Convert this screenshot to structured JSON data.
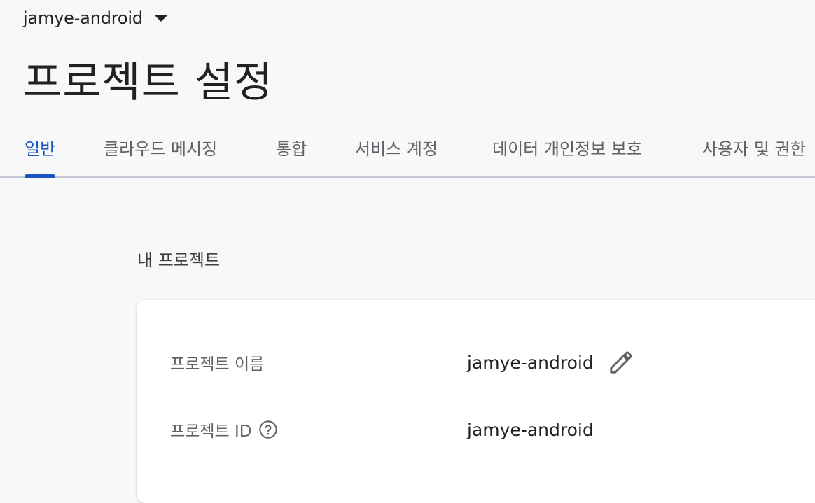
{
  "header": {
    "project_name": "jamye-android",
    "caret_icon": "arrow-drop-down-icon"
  },
  "page": {
    "title": "프로젝트 설정"
  },
  "tabs": [
    {
      "label": "일반",
      "active": true
    },
    {
      "label": "클라우드 메시징",
      "active": false
    },
    {
      "label": "통합",
      "active": false
    },
    {
      "label": "서비스 계정",
      "active": false
    },
    {
      "label": "데이터 개인정보 보호",
      "active": false
    },
    {
      "label": "사용자 및 권한",
      "active": false
    }
  ],
  "section": {
    "heading": "내 프로젝트"
  },
  "project_card": {
    "name_label": "프로젝트 이름",
    "name_value": "jamye-android",
    "edit_icon": "pencil-icon",
    "id_label": "프로젝트 ID",
    "id_value": "jamye-android",
    "help_icon": "help-circle-icon"
  },
  "colors": {
    "accent": "#1a57c5",
    "background": "#f8f8f8",
    "card": "#ffffff",
    "text_primary": "#202124",
    "text_secondary": "#5f6368"
  }
}
